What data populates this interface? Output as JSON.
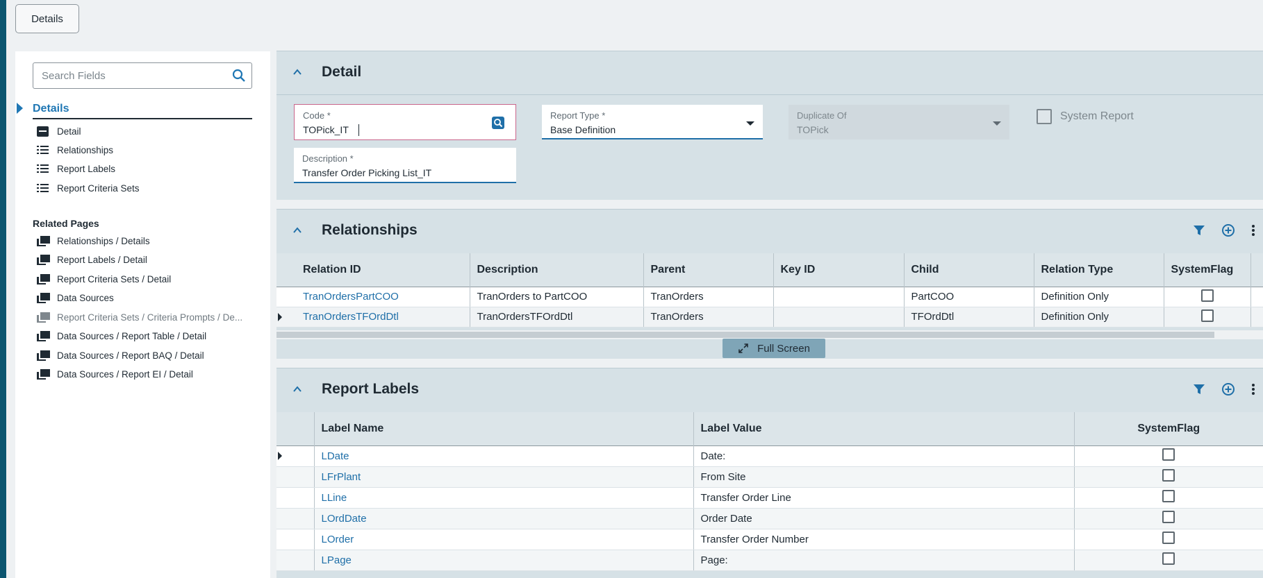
{
  "top_button": {
    "label": "Details"
  },
  "sidebar": {
    "search_placeholder": "Search Fields",
    "nav_header": "Details",
    "items": [
      {
        "label": "Detail",
        "icon": "card-icon"
      },
      {
        "label": "Relationships",
        "icon": "list-icon"
      },
      {
        "label": "Report Labels",
        "icon": "list-icon"
      },
      {
        "label": "Report Criteria Sets",
        "icon": "list-icon"
      }
    ],
    "related_header": "Related Pages",
    "related": [
      {
        "label": "Relationships / Details"
      },
      {
        "label": "Report Labels / Detail"
      },
      {
        "label": "Report Criteria Sets / Detail"
      },
      {
        "label": "Data Sources"
      },
      {
        "label": "Report Criteria Sets / Criteria Prompts / De..."
      },
      {
        "label": "Data Sources / Report Table / Detail"
      },
      {
        "label": "Data Sources / Report BAQ / Detail"
      },
      {
        "label": "Data Sources / Report EI / Detail"
      }
    ]
  },
  "detail": {
    "title": "Detail",
    "code": {
      "label": "Code *",
      "value": "TOPick_IT"
    },
    "report_type": {
      "label": "Report Type *",
      "value": "Base Definition"
    },
    "duplicate_of": {
      "label": "Duplicate Of",
      "value": "TOPick"
    },
    "system_report": {
      "label": "System Report",
      "checked": false
    },
    "description": {
      "label": "Description *",
      "value": "Transfer Order Picking List_IT"
    }
  },
  "relationships": {
    "title": "Relationships",
    "columns": [
      "Relation ID",
      "Description",
      "Parent",
      "Key ID",
      "Child",
      "Relation Type",
      "SystemFlag"
    ],
    "rows": [
      [
        "TranOrdersPartCOO",
        "TranOrders to PartCOO",
        "TranOrders",
        "",
        "PartCOO",
        "Definition Only"
      ],
      [
        "TranOrdersTFOrdDtl",
        "TranOrdersTFOrdDtl",
        "TranOrders",
        "",
        "TFOrdDtl",
        "Definition Only"
      ]
    ],
    "fullscreen_label": "Full Screen"
  },
  "report_labels": {
    "title": "Report Labels",
    "columns": [
      "Label Name",
      "Label Value",
      "SystemFlag"
    ],
    "rows": [
      [
        "LDate",
        "Date:"
      ],
      [
        "LFrPlant",
        "From Site"
      ],
      [
        "LLine",
        "Transfer Order Line"
      ],
      [
        "LOrdDate",
        "Order Date"
      ],
      [
        "LOrder",
        "Transfer Order Number"
      ],
      [
        "LPage",
        "Page:"
      ]
    ]
  },
  "colors": {
    "accent": "#1f77b4",
    "panel_bg": "#d6e1e6",
    "stripe": "#0c5670"
  }
}
